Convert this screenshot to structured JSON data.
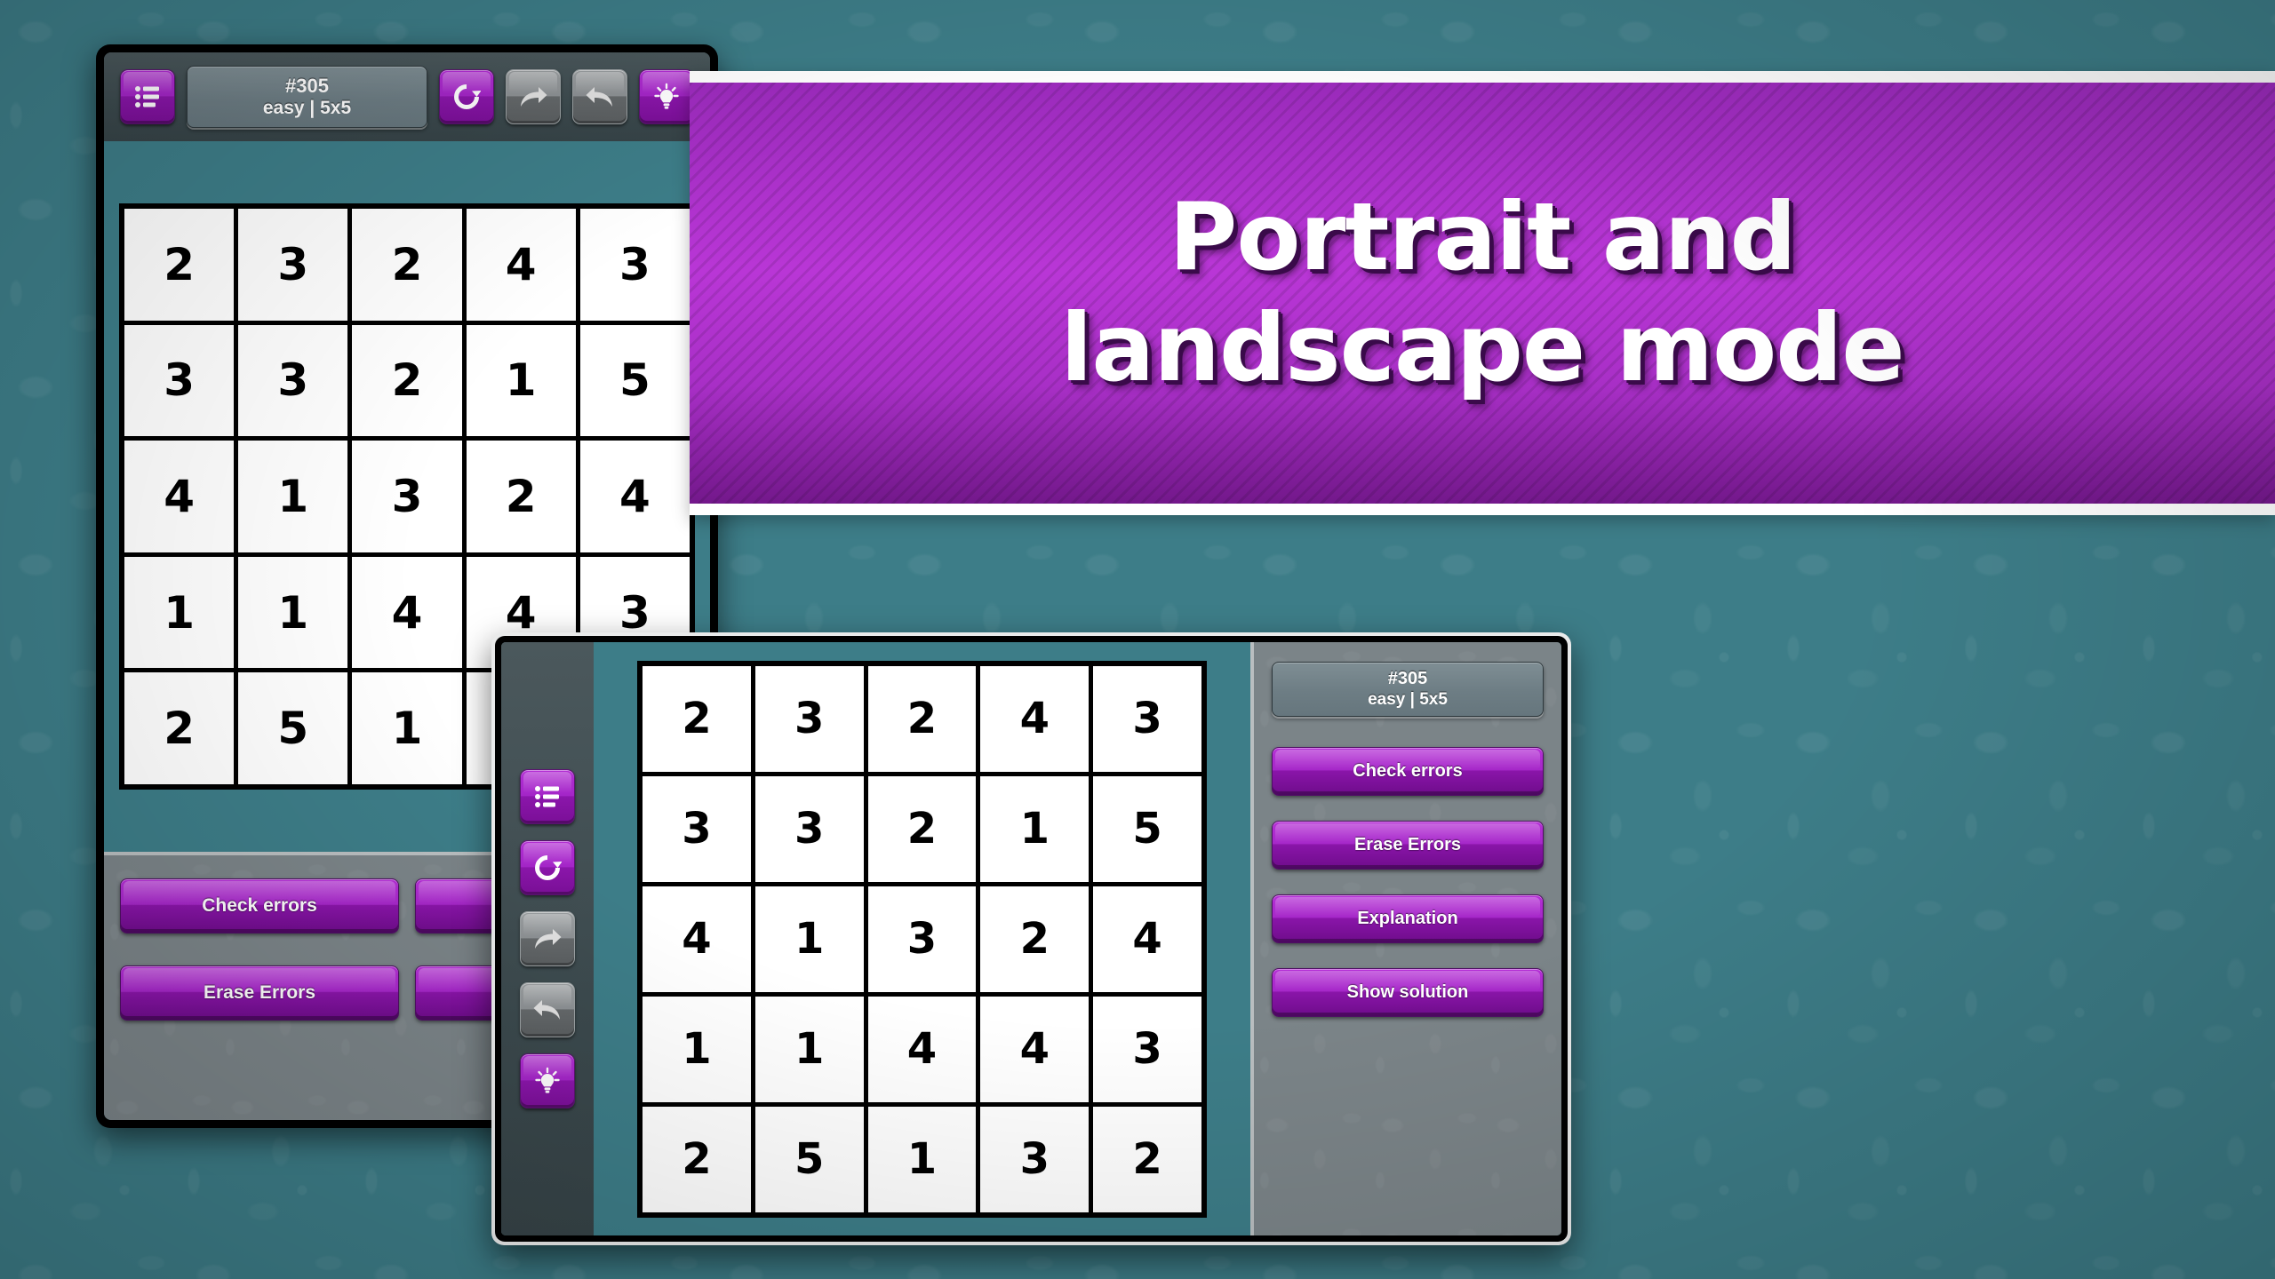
{
  "banner": {
    "line1": "Portrait and",
    "line2": "landscape mode"
  },
  "puzzle": {
    "id": "#305",
    "subtitle": "easy | 5x5",
    "rows": [
      [
        "2",
        "3",
        "2",
        "4",
        "3"
      ],
      [
        "3",
        "3",
        "2",
        "1",
        "5"
      ],
      [
        "4",
        "1",
        "3",
        "2",
        "4"
      ],
      [
        "1",
        "1",
        "4",
        "4",
        "3"
      ],
      [
        "2",
        "5",
        "1",
        "3",
        "2"
      ]
    ]
  },
  "toolbar": {
    "menu": "menu-list-icon",
    "restart": "restart-icon",
    "redo": "redo-icon",
    "undo": "undo-icon",
    "hint": "lightbulb-hint-icon"
  },
  "actions": {
    "check_errors": "Check errors",
    "erase_errors": "Erase Errors",
    "explanation": "Explanation",
    "show_solution": "Show solution"
  },
  "colors": {
    "background": "#3d7d88",
    "accent_purple": "#a426c8",
    "panel_gray": "#7b8488",
    "chrome": "#414f53",
    "banner_purple": "#a12cc0"
  }
}
